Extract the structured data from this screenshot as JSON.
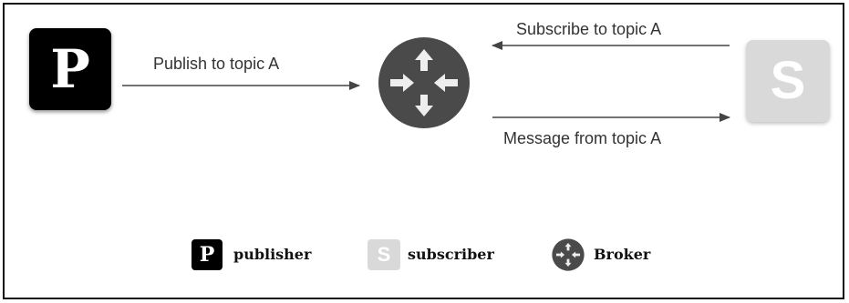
{
  "nodes": {
    "publisher_letter": "P",
    "subscriber_letter": "S"
  },
  "edges": {
    "publish": "Publish to topic A",
    "subscribe": "Subscribe to topic A",
    "message": "Message from topic A"
  },
  "legend": {
    "publisher_letter": "P",
    "publisher_label": "publisher",
    "subscriber_letter": "S",
    "subscriber_label": "subscriber",
    "broker_label": "Broker"
  },
  "colors": {
    "publisher": "#000000",
    "subscriber": "#d9d9d9",
    "broker": "#4a4a4a",
    "arrow": "#444444"
  },
  "icons": {
    "broker": "four-arrows-converging-icon"
  }
}
